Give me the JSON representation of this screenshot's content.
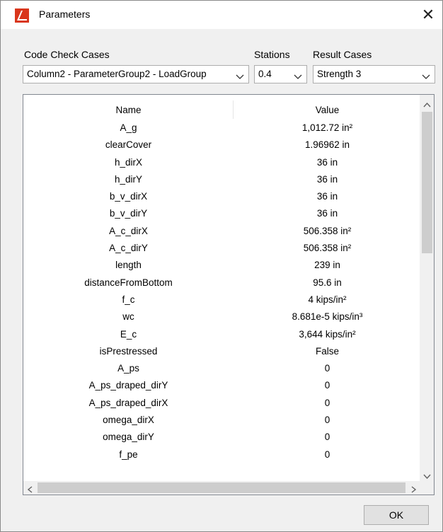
{
  "window": {
    "title": "Parameters",
    "close_glyph": "✕"
  },
  "labels": {
    "code_check_cases": "Code Check Cases",
    "stations": "Stations",
    "result_cases": "Result Cases"
  },
  "combos": {
    "code_check_case": "Column2 - ParameterGroup2 - LoadGroup",
    "station": "0.4",
    "result_case": "Strength 3"
  },
  "table": {
    "headers": [
      "Name",
      "Value"
    ],
    "rows": [
      [
        "A_g",
        "1,012.72 in²"
      ],
      [
        "clearCover",
        "1.96962 in"
      ],
      [
        "h_dirX",
        "36 in"
      ],
      [
        "h_dirY",
        "36 in"
      ],
      [
        "b_v_dirX",
        "36 in"
      ],
      [
        "b_v_dirY",
        "36 in"
      ],
      [
        "A_c_dirX",
        "506.358 in²"
      ],
      [
        "A_c_dirY",
        "506.358 in²"
      ],
      [
        "length",
        "239 in"
      ],
      [
        "distanceFromBottom",
        "95.6 in"
      ],
      [
        "f_c",
        "4 kips/in²"
      ],
      [
        "wc",
        "8.681e-5 kips/in³"
      ],
      [
        "E_c",
        "3,644 kips/in²"
      ],
      [
        "isPrestressed",
        "False"
      ],
      [
        "A_ps",
        "0"
      ],
      [
        "A_ps_draped_dirY",
        "0"
      ],
      [
        "A_ps_draped_dirX",
        "0"
      ],
      [
        "omega_dirX",
        "0"
      ],
      [
        "omega_dirY",
        "0"
      ],
      [
        "f_pe",
        "0"
      ]
    ]
  },
  "buttons": {
    "ok": "OK"
  },
  "icons": {
    "app": "app-logo-icon",
    "close": "close-icon",
    "combo": "chevron-down-icon",
    "scroll_up": "scroll-up-arrow-icon",
    "scroll_down": "scroll-down-arrow-icon",
    "scroll_left": "scroll-left-arrow-icon",
    "scroll_right": "scroll-right-arrow-icon"
  },
  "colors": {
    "logo": "#d9361c",
    "window_bg": "#f0f0f0"
  }
}
